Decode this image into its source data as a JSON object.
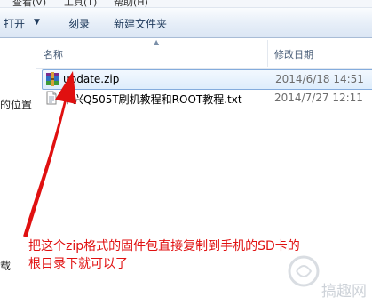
{
  "menu": {
    "items": [
      "查看(V)",
      "工具(T)",
      "帮助(H)"
    ]
  },
  "toolbar": {
    "open_label": "打开",
    "burn_label": "刻录",
    "new_folder_label": "新建文件夹"
  },
  "nav": {
    "partial_texts": [
      "的位置",
      "载"
    ]
  },
  "columns": {
    "name": "名称",
    "modified": "修改日期"
  },
  "files": [
    {
      "name": "update.zip",
      "modified": "2014/6/18 14:51",
      "icon": "winrar-archive-icon",
      "selected": true
    },
    {
      "name": "中兴Q505T刷机教程和ROOT教程.txt",
      "modified": "2014/7/27 12:11",
      "icon": "text-file-icon",
      "selected": false
    }
  ],
  "annotation": {
    "line1": "把这个zip格式的固件包直接复制到手机的SD卡的",
    "line2": "根目录下就可以了"
  },
  "watermark": {
    "text": "搞趣网"
  },
  "colors": {
    "annotation": "#e01010",
    "selection_border": "#84acdd",
    "toolbar_bg": "#e6eef8"
  }
}
